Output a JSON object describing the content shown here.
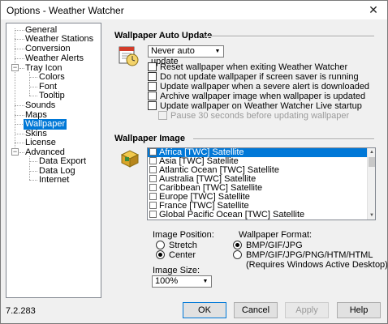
{
  "window": {
    "title": "Options - Weather Watcher"
  },
  "tree": {
    "general": "General",
    "weather_stations": "Weather Stations",
    "conversion": "Conversion",
    "weather_alerts": "Weather Alerts",
    "tray_icon": "Tray Icon",
    "colors": "Colors",
    "font": "Font",
    "tooltip": "Tooltip",
    "sounds": "Sounds",
    "maps": "Maps",
    "wallpaper": "Wallpaper",
    "skins": "Skins",
    "license": "License",
    "advanced": "Advanced",
    "data_export": "Data Export",
    "data_log": "Data Log",
    "internet": "Internet"
  },
  "auto_update": {
    "title": "Wallpaper Auto Update",
    "combo_value": "Never auto update",
    "options": [
      {
        "label": "Reset wallpaper when exiting Weather Watcher",
        "checked": false
      },
      {
        "label": "Do not update wallpaper if screen saver is running",
        "checked": false
      },
      {
        "label": "Update wallpaper when a severe alert is downloaded",
        "checked": false
      },
      {
        "label": "Archive wallpaper image when wallpaper is updated",
        "checked": false
      },
      {
        "label": "Update wallpaper on Weather Watcher Live startup",
        "checked": false
      },
      {
        "label": "Pause 30 seconds before updating wallpaper",
        "checked": false,
        "disabled": true
      }
    ]
  },
  "image": {
    "title": "Wallpaper Image",
    "list": [
      "Africa [TWC] Satellite",
      "Asia [TWC] Satellite",
      "Atlantic Ocean [TWC] Satellite",
      "Australia [TWC] Satellite",
      "Caribbean [TWC] Satellite",
      "Europe [TWC] Satellite",
      "France [TWC] Satellite",
      "Global Pacific Ocean [TWC] Satellite"
    ],
    "selected_index": 0,
    "position_label": "Image Position:",
    "position_stretch": "Stretch",
    "position_center": "Center",
    "position_selected": "center",
    "format_label": "Wallpaper Format:",
    "format_bmp": "BMP/GIF/JPG",
    "format_full": "BMP/GIF/JPG/PNG/HTM/HTML",
    "format_note": "(Requires Windows Active Desktop)",
    "format_selected": "bmp",
    "size_label": "Image Size:",
    "size_value": "100%"
  },
  "footer": {
    "version": "7.2.283",
    "ok": "OK",
    "cancel": "Cancel",
    "apply": "Apply",
    "help": "Help"
  },
  "colors": {
    "accent": "#0078d7"
  }
}
